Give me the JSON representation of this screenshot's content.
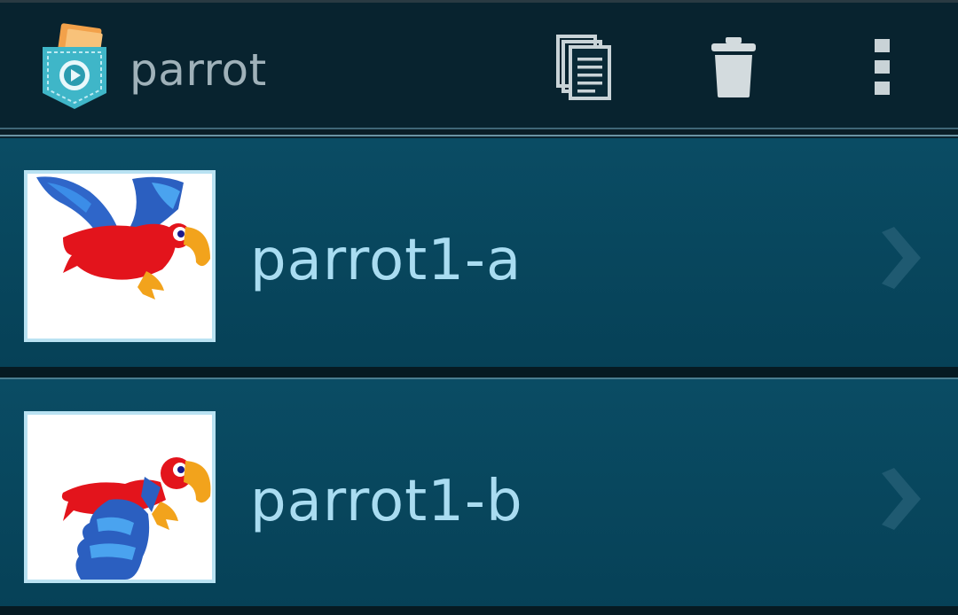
{
  "action_bar": {
    "title": "parrot",
    "app_icon": "pocket-video-icon",
    "actions": [
      {
        "name": "copy",
        "icon": "copy-icon"
      },
      {
        "name": "delete",
        "icon": "trash-icon"
      },
      {
        "name": "more",
        "icon": "overflow-menu-icon"
      }
    ]
  },
  "items": [
    {
      "label": "parrot1-a",
      "thumbnail": "parrot-flying-wings-up-image",
      "icon": "chevron-right-icon"
    },
    {
      "label": "parrot1-b",
      "thumbnail": "parrot-flying-wings-down-image",
      "icon": "chevron-right-icon"
    }
  ],
  "colors": {
    "action_bar_bg": "#08232f",
    "list_item_bg": "#0a4c64",
    "label_text": "#a9dcf1",
    "thumb_border": "#b9e2f2",
    "title_text": "#9fb1b9"
  }
}
